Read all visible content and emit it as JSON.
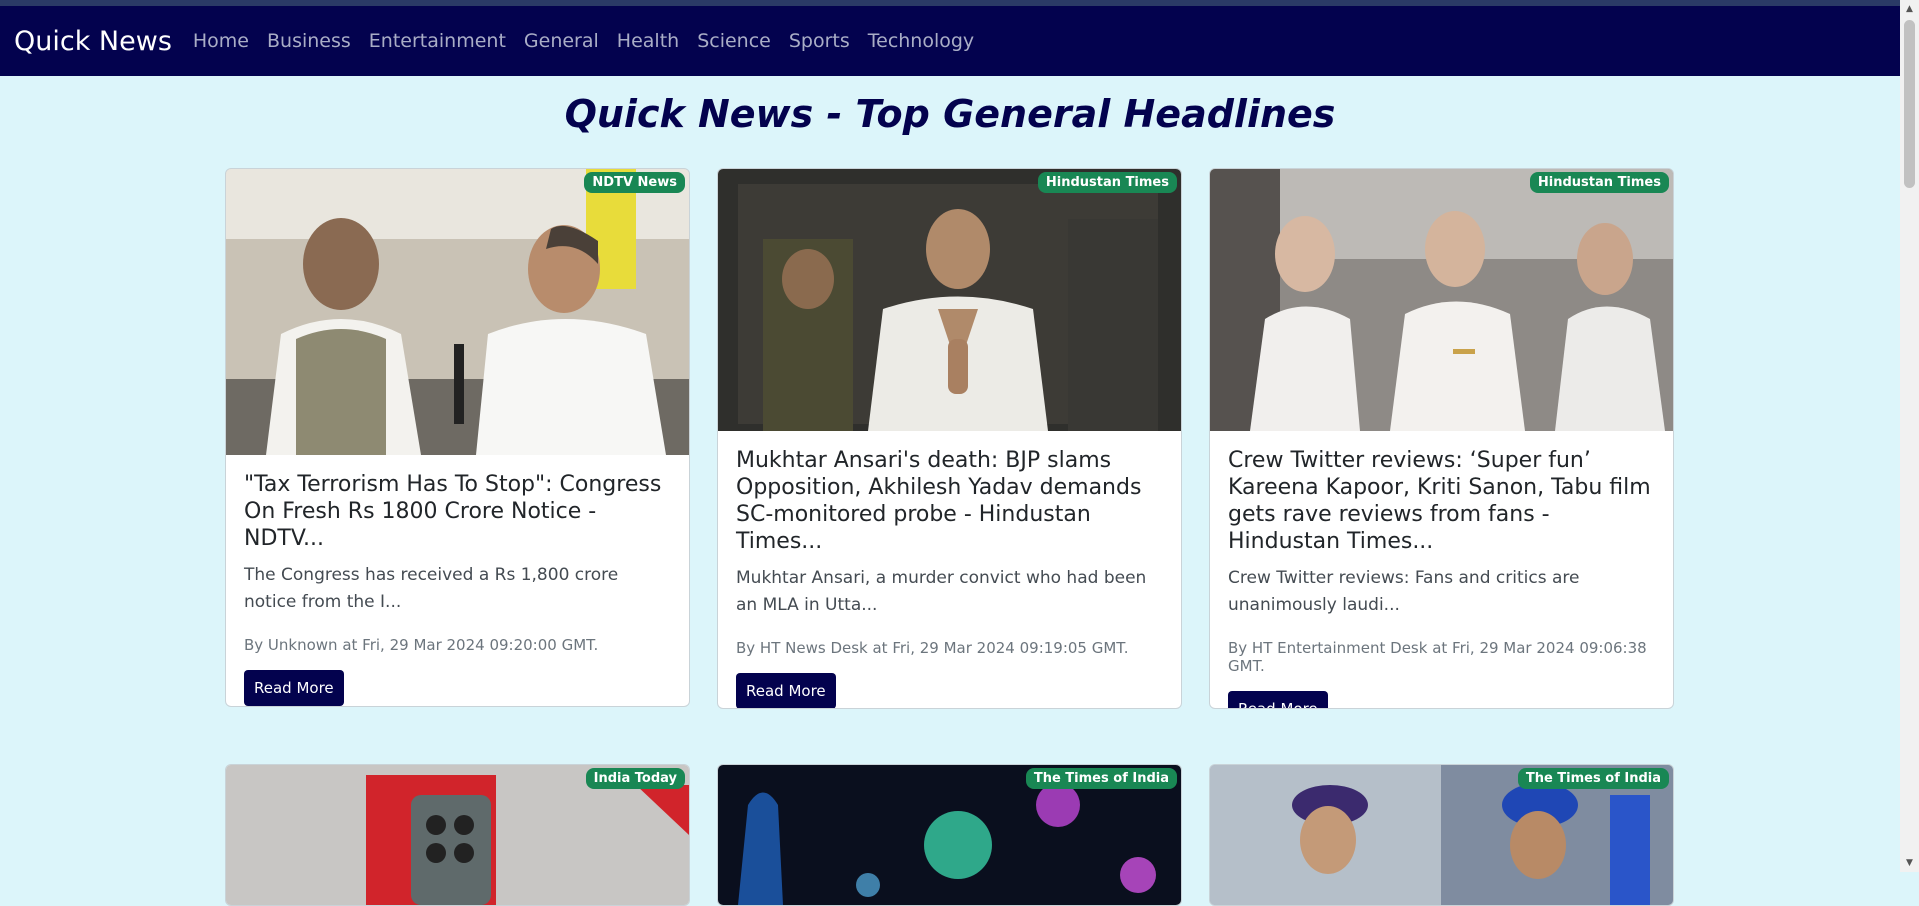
{
  "navbar": {
    "brand": "Quick News",
    "links": [
      "Home",
      "Business",
      "Entertainment",
      "General",
      "Health",
      "Science",
      "Sports",
      "Technology"
    ]
  },
  "page_title": "Quick News - Top General Headlines",
  "colors": {
    "navbar_bg": "#03024e",
    "page_bg": "#dcf5fa",
    "badge_bg": "#198754",
    "button_bg": "#03024e"
  },
  "cards": [
    {
      "source": "NDTV News",
      "title": "\"Tax Terrorism Has To Stop\": Congress On Fresh Rs 1800 Crore Notice - NDTV...",
      "description": "The Congress has received a Rs 1,800 crore notice from the I...",
      "meta": "By Unknown at Fri, 29 Mar 2024 09:20:00 GMT.",
      "button": "Read More"
    },
    {
      "source": "Hindustan Times",
      "title": "Mukhtar Ansari's death: BJP slams Opposition, Akhilesh Yadav demands SC-monitored probe - Hindustan Times...",
      "description": "Mukhtar Ansari, a murder convict who had been an MLA in Utta...",
      "meta": "By HT News Desk at Fri, 29 Mar 2024 09:19:05 GMT.",
      "button": "Read More"
    },
    {
      "source": "Hindustan Times",
      "title": "Crew Twitter reviews: ‘Super fun’ Kareena Kapoor, Kriti Sanon, Tabu film gets rave reviews from fans - Hindustan Times...",
      "description": "Crew Twitter reviews: Fans and critics are unanimously laudi...",
      "meta": "By HT Entertainment Desk at Fri, 29 Mar 2024 09:06:38 GMT.",
      "button": "Read More"
    },
    {
      "source": "India Today"
    },
    {
      "source": "The Times of India"
    },
    {
      "source": "The Times of India"
    }
  ]
}
